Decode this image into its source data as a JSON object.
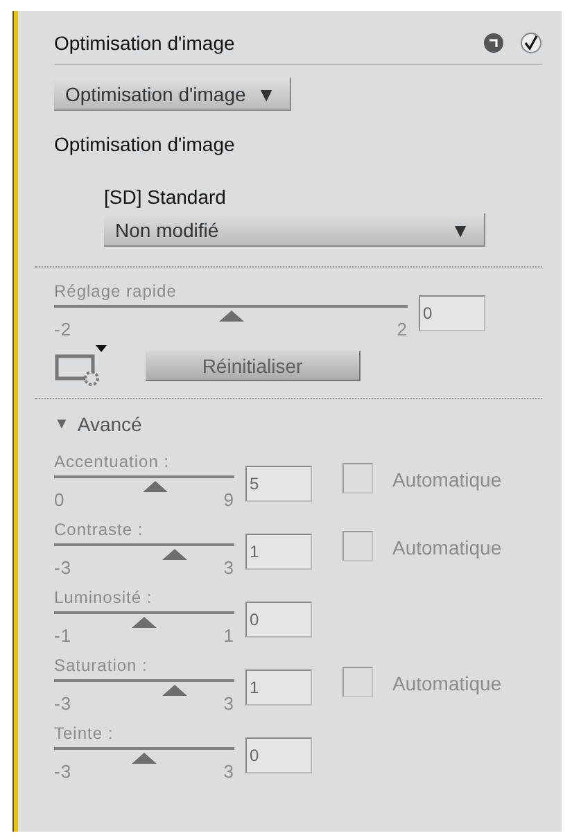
{
  "panel": {
    "title": "Optimisation d'image"
  },
  "preset_dropdown": {
    "value": "Optimisation d'image",
    "arrow": "▼"
  },
  "section_label": "Optimisation d'image",
  "style_name": "[SD] Standard",
  "style_dropdown": {
    "value": "Non modifié",
    "arrow": "▼"
  },
  "quick_adjust": {
    "label": "Réglage rapide",
    "min": "-2",
    "max": "2",
    "level": 0.5,
    "value": "0"
  },
  "reset_button": "Réinitialiser",
  "advanced": {
    "arrow": "▼",
    "label": "Avancé",
    "expanded": true
  },
  "sliders": [
    {
      "label": "Accentuation :",
      "min": "0",
      "max": "9",
      "level": 0.56,
      "value": "5",
      "auto": {
        "label": "Automatique",
        "checked": false
      }
    },
    {
      "label": "Contraste :",
      "min": "-3",
      "max": "3",
      "level": 0.67,
      "value": "1",
      "auto": {
        "label": "Automatique",
        "checked": false
      }
    },
    {
      "label": "Luminosité :",
      "min": "-1",
      "max": "1",
      "level": 0.5,
      "value": "0"
    },
    {
      "label": "Saturation :",
      "min": "-3",
      "max": "3",
      "level": 0.67,
      "value": "1",
      "auto": {
        "label": "Automatique",
        "checked": false
      }
    },
    {
      "label": "Teinte :",
      "min": "-3",
      "max": "3",
      "level": 0.5,
      "value": "0"
    }
  ]
}
